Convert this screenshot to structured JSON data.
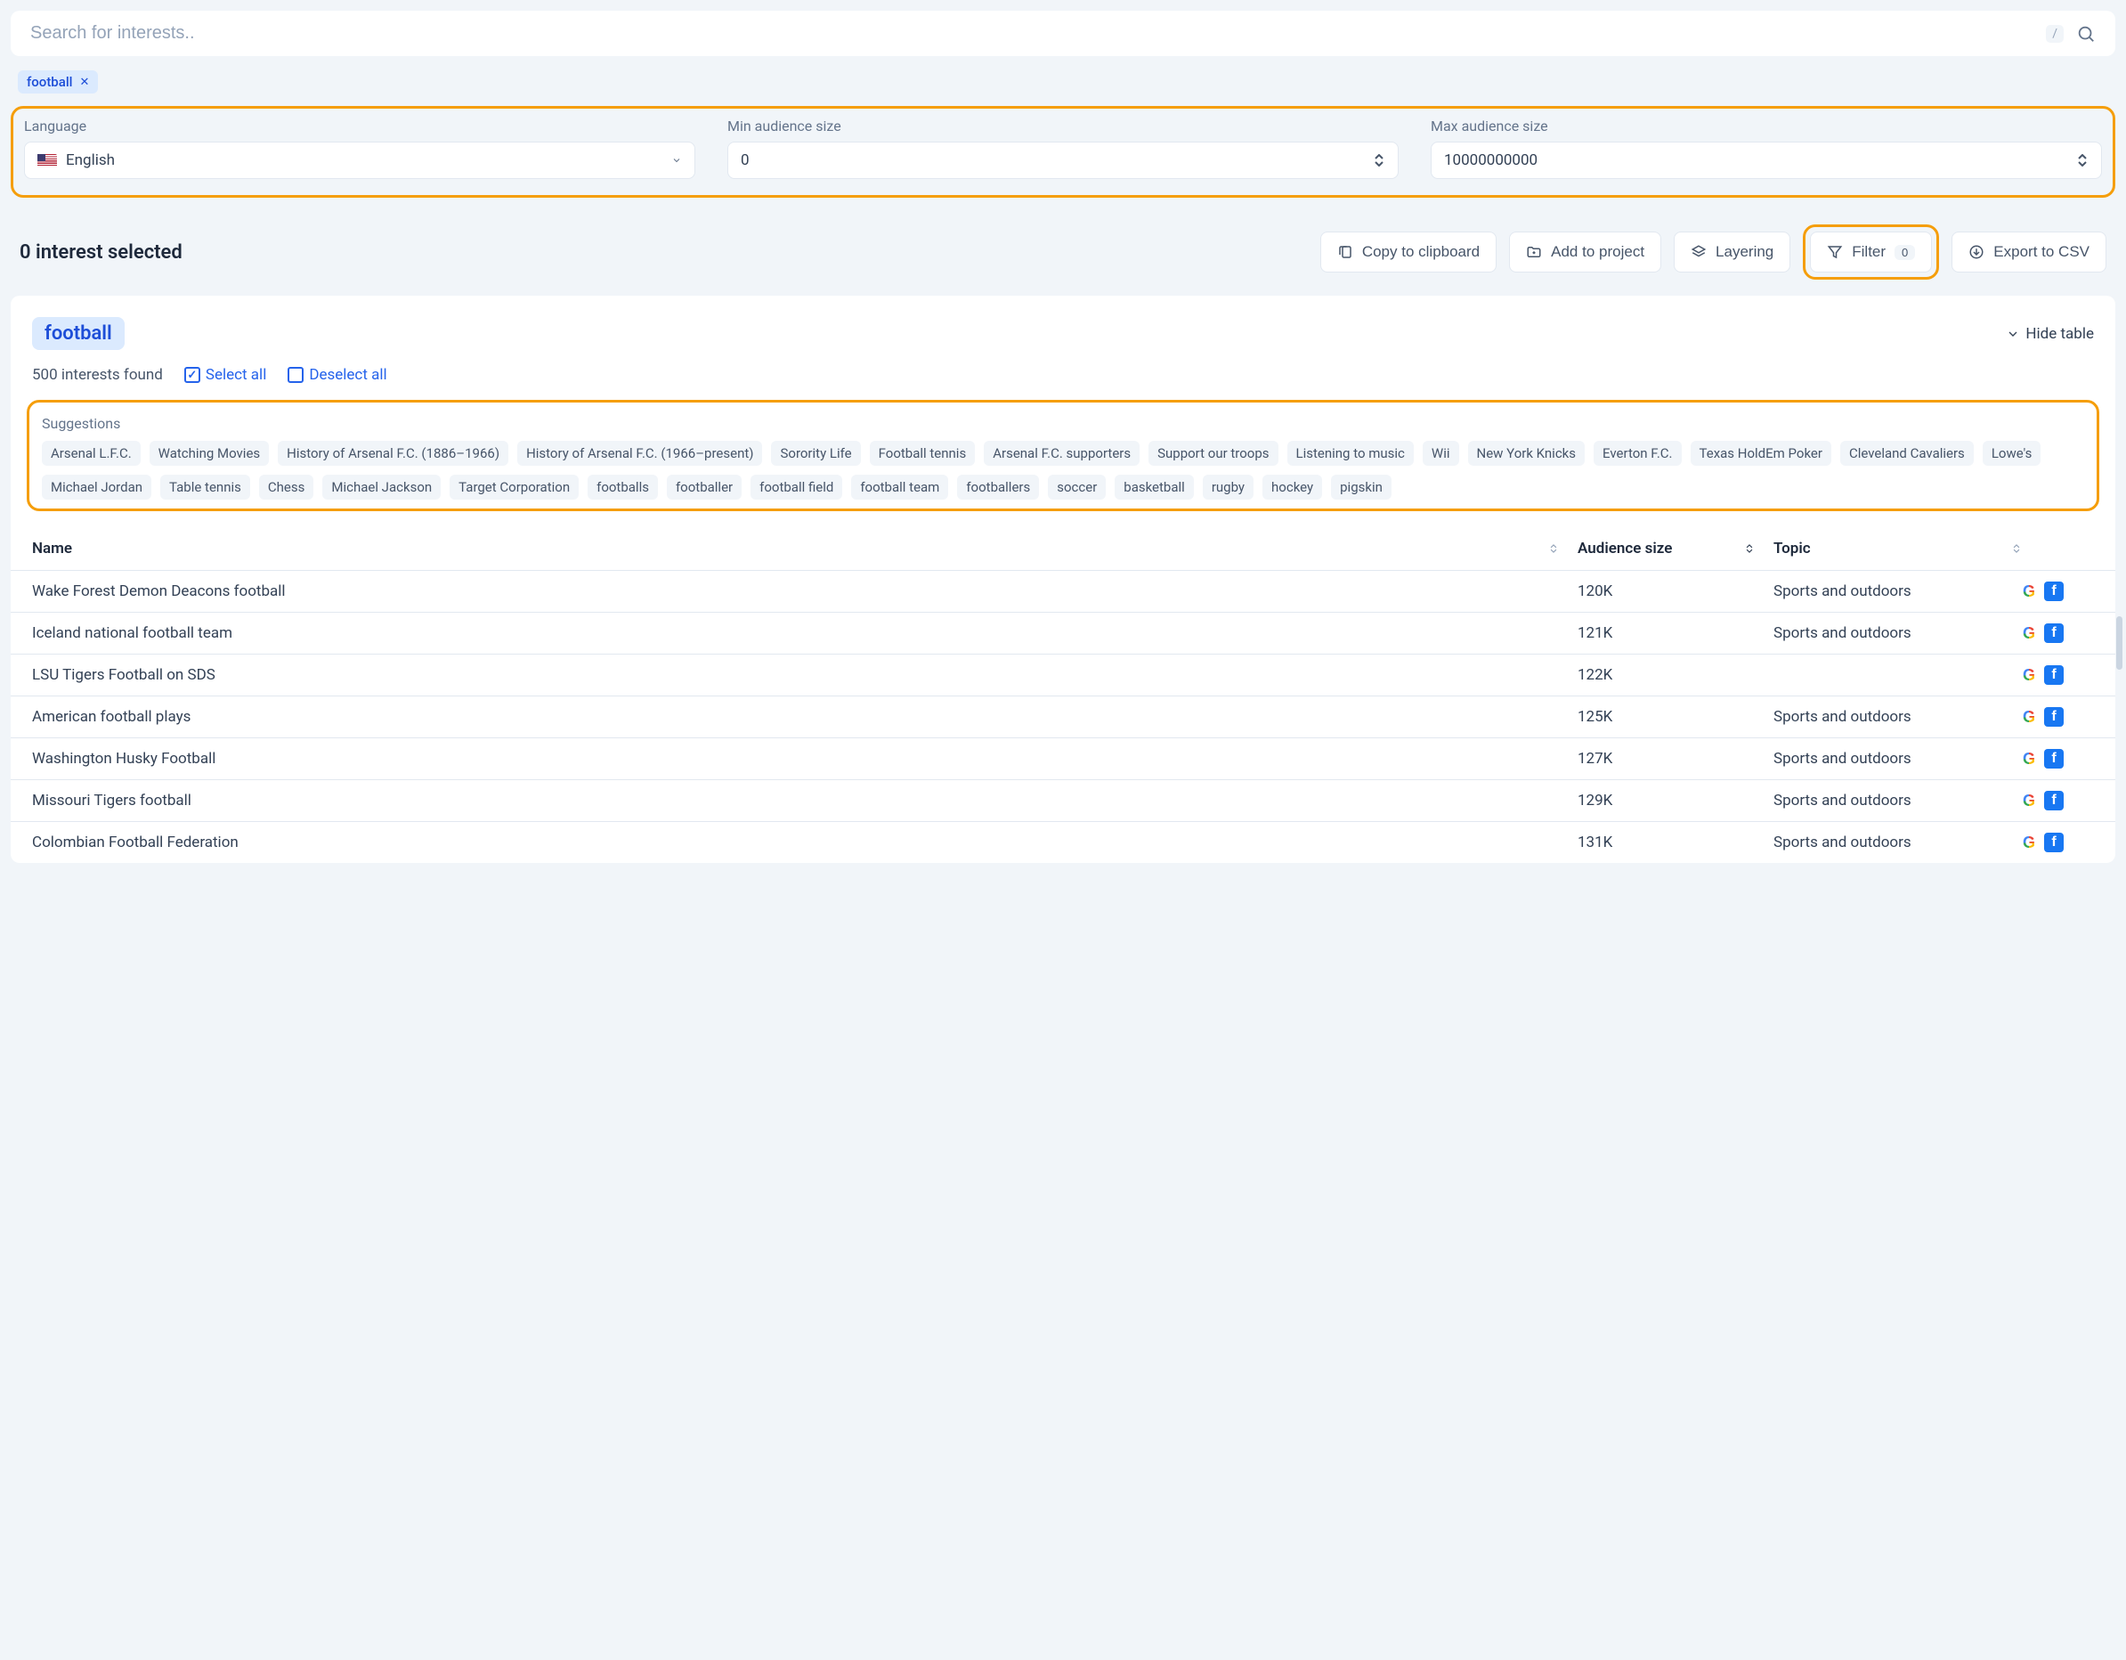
{
  "search": {
    "placeholder": "Search for interests..",
    "shortcut": "/",
    "chip": "football"
  },
  "filters": {
    "language": {
      "label": "Language",
      "value": "English"
    },
    "min": {
      "label": "Min audience size",
      "value": "0"
    },
    "max": {
      "label": "Max audience size",
      "value": "10000000000"
    }
  },
  "actions": {
    "selected": "0 interest selected",
    "copy": "Copy to clipboard",
    "add": "Add to project",
    "layering": "Layering",
    "filter": "Filter",
    "filter_count": "0",
    "export": "Export to CSV"
  },
  "card": {
    "tag": "football",
    "hide": "Hide table",
    "found": "500 interests found",
    "select_all": "Select all",
    "deselect_all": "Deselect all"
  },
  "suggestions": {
    "label": "Suggestions",
    "items": [
      "Arsenal L.F.C.",
      "Watching Movies",
      "History of Arsenal F.C. (1886–1966)",
      "History of Arsenal F.C. (1966–present)",
      "Sorority Life",
      "Football tennis",
      "Arsenal F.C. supporters",
      "Support our troops",
      "Listening to music",
      "Wii",
      "New York Knicks",
      "Everton F.C.",
      "Texas HoldEm Poker",
      "Cleveland Cavaliers",
      "Lowe's",
      "Michael Jordan",
      "Table tennis",
      "Chess",
      "Michael Jackson",
      "Target Corporation",
      "footballs",
      "footballer",
      "football field",
      "football team",
      "footballers",
      "soccer",
      "basketball",
      "rugby",
      "hockey",
      "pigskin"
    ]
  },
  "columns": {
    "name": "Name",
    "audience": "Audience size",
    "topic": "Topic"
  },
  "rows": [
    {
      "name": "Wake Forest Demon Deacons football",
      "audience": "120K",
      "topic": "Sports and outdoors"
    },
    {
      "name": "Iceland national football team",
      "audience": "121K",
      "topic": "Sports and outdoors"
    },
    {
      "name": "LSU Tigers Football on SDS",
      "audience": "122K",
      "topic": ""
    },
    {
      "name": "American football plays",
      "audience": "125K",
      "topic": "Sports and outdoors"
    },
    {
      "name": "Washington Husky Football",
      "audience": "127K",
      "topic": "Sports and outdoors"
    },
    {
      "name": "Missouri Tigers football",
      "audience": "129K",
      "topic": "Sports and outdoors"
    },
    {
      "name": "Colombian Football Federation",
      "audience": "131K",
      "topic": "Sports and outdoors"
    }
  ]
}
